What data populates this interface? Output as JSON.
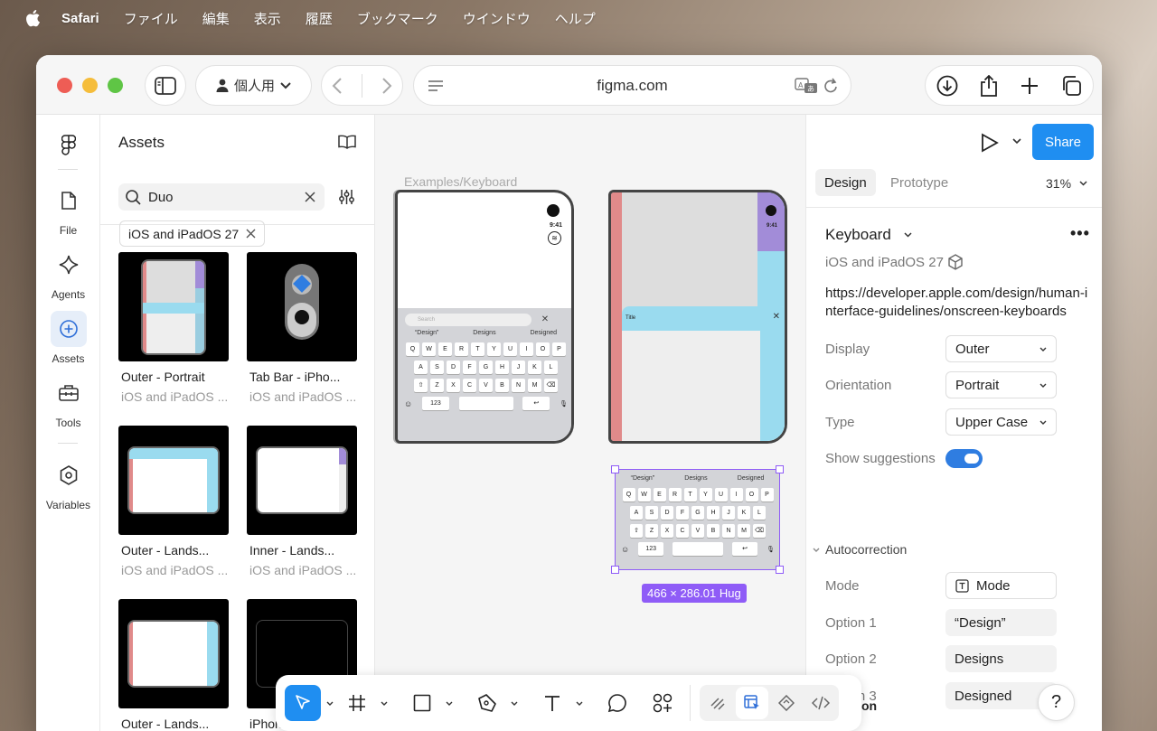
{
  "menubar": {
    "app": "Safari",
    "items": [
      "ファイル",
      "編集",
      "表示",
      "履歴",
      "ブックマーク",
      "ウインドウ",
      "ヘルプ"
    ]
  },
  "browser": {
    "profile": "個人用",
    "url": "figma.com"
  },
  "nav": {
    "file": "File",
    "agents": "Agents",
    "assets": "Assets",
    "tools": "Tools",
    "variables": "Variables"
  },
  "assets": {
    "title": "Assets",
    "search_value": "Duo",
    "filter_chip": "iOS and iPadOS 27",
    "cards": [
      {
        "title": "Outer - Portrait",
        "subtitle": "iOS and iPadOS ..."
      },
      {
        "title": "Tab Bar - iPho...",
        "subtitle": "iOS and iPadOS ..."
      },
      {
        "title": "Outer - Lands...",
        "subtitle": "iOS and iPadOS ..."
      },
      {
        "title": "Inner - Lands...",
        "subtitle": "iOS and iPadOS ..."
      },
      {
        "title": "Outer - Lands...",
        "subtitle": ""
      },
      {
        "title": "iPhon...",
        "subtitle": ""
      }
    ]
  },
  "canvas": {
    "frame_label": "Examples/Keyboard",
    "phone_time": "9:41",
    "search_placeholder": "Search",
    "suggestions": [
      "“Design”",
      "Designs",
      "Designed"
    ],
    "row1": [
      "Q",
      "W",
      "E",
      "R",
      "T",
      "Y",
      "U",
      "I",
      "O",
      "P"
    ],
    "row2": [
      "A",
      "S",
      "D",
      "F",
      "G",
      "H",
      "J",
      "K",
      "L"
    ],
    "row3": [
      "Z",
      "X",
      "C",
      "V",
      "B",
      "N",
      "M"
    ],
    "num_key": "123",
    "title_text": "Title",
    "size_label": "466 × 286.01 Hug"
  },
  "panel": {
    "share": "Share",
    "tab_design": "Design",
    "tab_prototype": "Prototype",
    "zoom": "31%",
    "component": "Keyboard",
    "library": "iOS and iPadOS 27",
    "link": "https://developer.apple.com/design/human-interface-guidelines/onscreen-keyboards",
    "display_label": "Display",
    "display_value": "Outer",
    "orientation_label": "Orientation",
    "orientation_value": "Portrait",
    "type_label": "Type",
    "type_value": "Upper Case",
    "suggestions_label": "Show suggestions",
    "autocorrection": "Autocorrection",
    "mode_label": "Mode",
    "mode_value": "Mode",
    "option1_label": "Option 1",
    "option1_value": "“Design”",
    "option2_label": "Option 2",
    "option2_value": "Designs",
    "option3_label": "Option 3",
    "option3_value": "Designed",
    "bottom_section": "on",
    "help": "?"
  },
  "colors": {
    "accent": "#1f8ef1",
    "selection": "#8f5cf7",
    "toggle": "#2f7de1"
  }
}
